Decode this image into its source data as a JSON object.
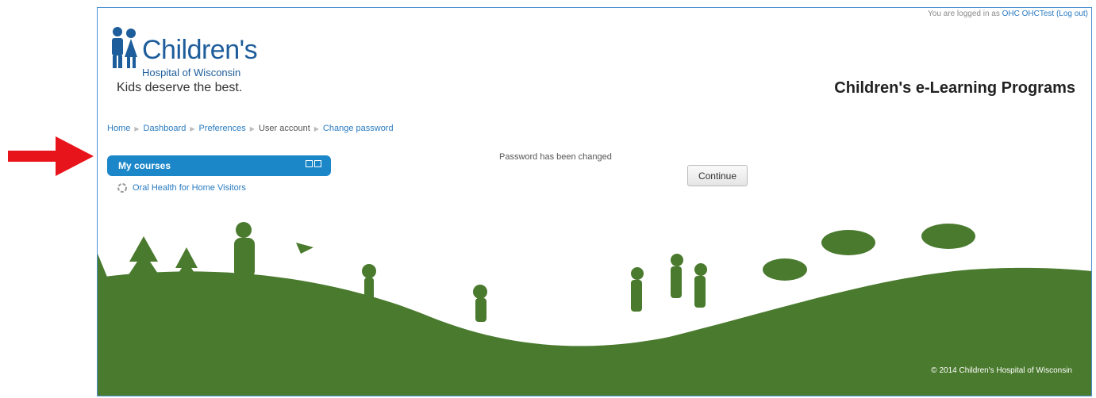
{
  "header": {
    "login_prefix": "You are logged in as ",
    "user_name": "OHC OHCTest",
    "logout_label": "(Log out)",
    "logo_title": "Children's",
    "logo_subtitle": "Hospital of Wisconsin",
    "tagline": "Kids deserve the best.",
    "site_title": "Children's e-Learning Programs"
  },
  "breadcrumb": [
    "Home",
    "Dashboard",
    "Preferences",
    "User account",
    "Change password"
  ],
  "sidebar": {
    "block_title": "My courses",
    "courses": [
      "Oral Health for Home Visitors"
    ]
  },
  "main": {
    "message": "Password has been changed",
    "continue_label": "Continue"
  },
  "footer": {
    "copyright": "© 2014 Children's Hospital of Wisconsin"
  },
  "colors": {
    "accent": "#1b87c9",
    "hill": "#4a7a2e",
    "arrow": "#e8141b"
  }
}
